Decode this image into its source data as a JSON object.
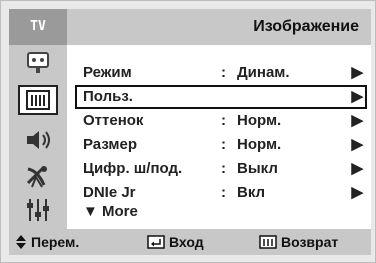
{
  "header": {
    "source_tag": "TV",
    "menu_title": "Изображение"
  },
  "sidebar": {
    "icons": [
      {
        "name": "input-icon"
      },
      {
        "name": "picture-icon",
        "active": true
      },
      {
        "name": "sound-icon"
      },
      {
        "name": "channel-icon"
      },
      {
        "name": "setup-icon"
      }
    ]
  },
  "menu": {
    "items": [
      {
        "label": "Режим",
        "colon": ":",
        "value": "Динам.",
        "arrow": "▶"
      },
      {
        "label": "Польз.",
        "colon": "",
        "value": "",
        "arrow": "▶"
      },
      {
        "label": "Оттенок",
        "colon": ":",
        "value": "Норм.",
        "arrow": "▶"
      },
      {
        "label": "Размер",
        "colon": ":",
        "value": "Норм.",
        "arrow": "▶"
      },
      {
        "label": "Цифр. ш/под.",
        "colon": ":",
        "value": "Выкл",
        "arrow": "▶"
      },
      {
        "label": "DNIe Jr",
        "colon": ":",
        "value": "Вкл",
        "arrow": "▶"
      }
    ],
    "more": "▼ More"
  },
  "footer": {
    "move": "Перем.",
    "enter": "Вход",
    "return": "Возврат"
  },
  "colors": {
    "panel": "#c8c8c8",
    "tag": "#9a9a9a",
    "selection_border": "#111111"
  }
}
